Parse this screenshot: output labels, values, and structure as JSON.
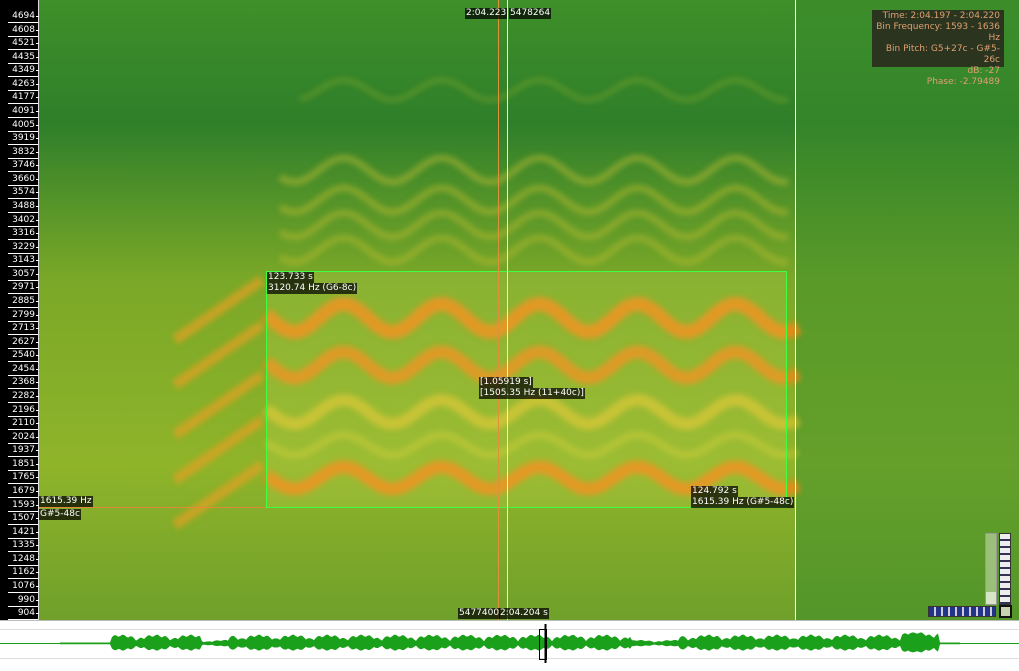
{
  "frequency_scale": {
    "unit": "Hz",
    "labels": [
      "4694",
      "4608",
      "4521",
      "4435",
      "4349",
      "4263",
      "4177",
      "4091",
      "4005",
      "3919",
      "3832",
      "3746",
      "3660",
      "3574",
      "3488",
      "3402",
      "3316",
      "3229",
      "3143",
      "3057",
      "2971",
      "2885",
      "2799",
      "2713",
      "2627",
      "2540",
      "2454",
      "2368",
      "2282",
      "2196",
      "2110",
      "2024",
      "1937",
      "1851",
      "1765",
      "1679",
      "1593",
      "1507",
      "1421",
      "1335",
      "1248",
      "1162",
      "1076",
      "990",
      "904"
    ]
  },
  "cursor": {
    "top_time": "2:04.223",
    "top_frame": "5478264",
    "bottom_frame": "5477400",
    "bottom_time": "2:04.204 s"
  },
  "selection": {
    "start_time": "123.733 s",
    "start_freq": "3120.74 Hz (G6-8c)",
    "duration": "[1.05919 s]",
    "range": "[1505.35 Hz (11+40c)]",
    "end_time": "124.792 s",
    "end_freq": "1615.39 Hz (G#5-48c)"
  },
  "hover": {
    "freq": "1615.39 Hz",
    "pitch": "G#5-48c"
  },
  "info_panel": {
    "time": "Time: 2:04.197 - 2:04.220",
    "bin_frequency": "Bin Frequency: 1593 - 1636 Hz",
    "bin_pitch": "Bin Pitch: G5+27c - G#5-26c",
    "db": "dB: -27",
    "phase": "Phase: -2.79489"
  },
  "colors": {
    "spectrogram_low": "#2e8a2a",
    "spectrogram_mid": "#b8c830",
    "spectrogram_high": "#e8881a",
    "selection_border": "#40ff40",
    "waveform": "#1aa01a",
    "info_text": "#e0a070"
  }
}
